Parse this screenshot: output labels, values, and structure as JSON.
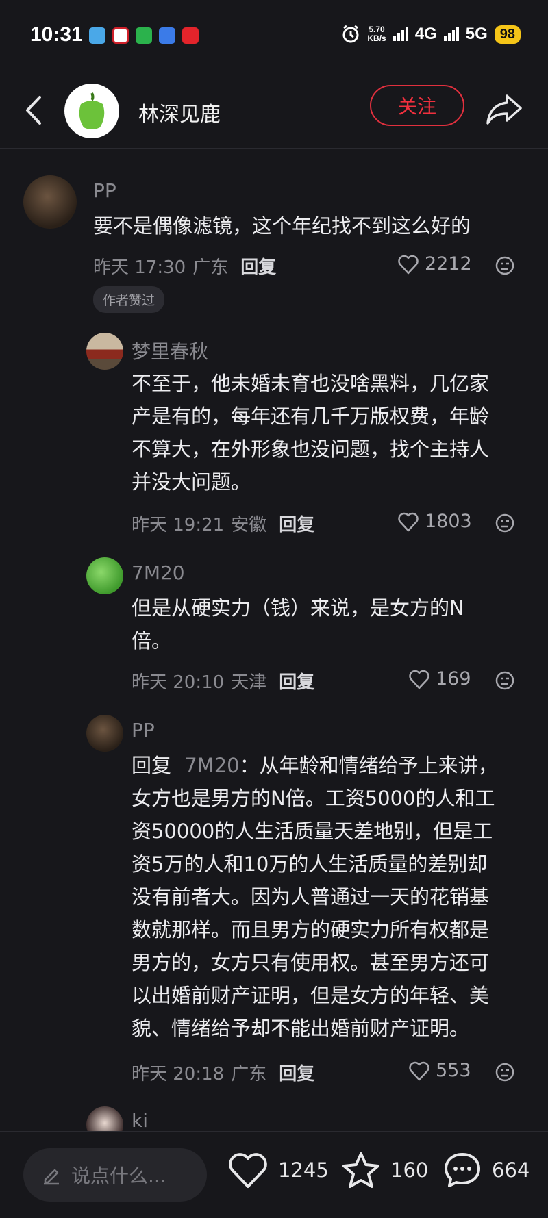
{
  "status_bar": {
    "time": "10:31",
    "net_speed_value": "5.70",
    "net_speed_unit": "KB/s",
    "signal_4g": "4G",
    "signal_5g": "5G",
    "battery": "98"
  },
  "header": {
    "username": "林深见鹿",
    "follow_label": "关注"
  },
  "comments": [
    {
      "name": "PP",
      "text": "要不是偶像滤镜，这个年纪找不到这么好的",
      "time": "昨天 17:30",
      "location": "广东",
      "reply_label": "回复",
      "likes": "2212",
      "badge": "作者赞过"
    },
    {
      "name": "梦里春秋",
      "text_lines": [
        "不至于，他未婚未育也没啥黑料，几亿家",
        "产是有的，每年还有几千万版权费，年龄",
        "不算大，在外形象也没问题，找个主持人",
        "并没大问题。"
      ],
      "time": "昨天 19:21",
      "location": "安徽",
      "reply_label": "回复",
      "likes": "1803"
    },
    {
      "name": "7M20",
      "text_lines": [
        "但是从硬实力（钱）来说，是女方的N",
        "倍。"
      ],
      "time": "昨天 20:10",
      "location": "天津",
      "reply_label": "回复",
      "likes": "169"
    },
    {
      "name": "PP",
      "reply_prefix": "回复",
      "reply_to": "7M20",
      "first_line_rest": "：从年龄和情绪给予上来讲，",
      "text_lines": [
        "女方也是男方的N倍。工资5000的人和工",
        "资50000的人生活质量天差地别，但是工",
        "资5万的人和10万的人生活质量的差别却",
        "没有前者大。因为人普通过一天的花销基",
        "数就那样。而且男方的硬实力所有权都是",
        "男方的，女方只有使用权。甚至男方还可",
        "以出婚前财产证明，但是女方的年轻、美",
        "貌、情绪给予却不能出婚前财产证明。"
      ],
      "time": "昨天 20:18",
      "location": "广东",
      "reply_label": "回复",
      "likes": "553"
    },
    {
      "name": "ki"
    }
  ],
  "bottom_bar": {
    "input_placeholder": "说点什么...",
    "likes": "1245",
    "stars": "160",
    "comments": "664"
  }
}
